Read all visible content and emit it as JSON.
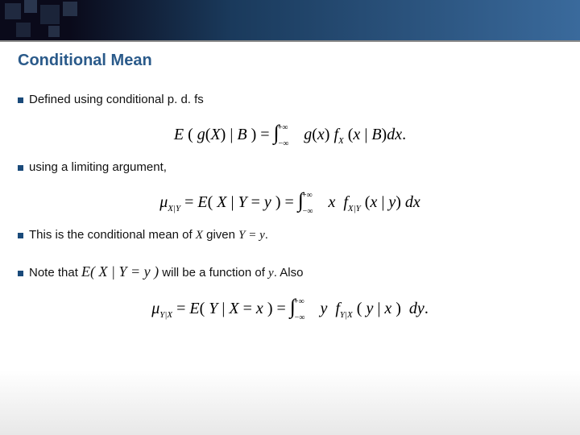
{
  "header": {
    "title": "Conditional Mean"
  },
  "bullets": {
    "b1": "Defined using conditional p. d. fs",
    "b2": "using a limiting argument,",
    "b3_pre": "This is ",
    "b3_bold": "the conditional mean of ",
    "b3_x": "X",
    "b3_mid": " given ",
    "b3_y": "Y = y",
    "b3_post": ".",
    "b4_pre": "Note that ",
    "b4_eq": "E( X | Y = y )",
    "b4_post1": " will be a function of ",
    "b4_var": "y",
    "b4_post2": ".  Also"
  },
  "equations": {
    "eq1": "E ( g(X) | B ) = ∫₋∞⁺∞ g(x) f_X (x | B) dx.",
    "eq2": "μ_{X|Y} = E( X | Y = y ) = ∫₋∞⁺∞ x  f_{X|Y} (x | y) dx",
    "eq3": "μ_{Y|X} = E( Y | X = x ) = ∫₋∞⁺∞ y  f_{Y|X} ( y | x )  dy."
  }
}
